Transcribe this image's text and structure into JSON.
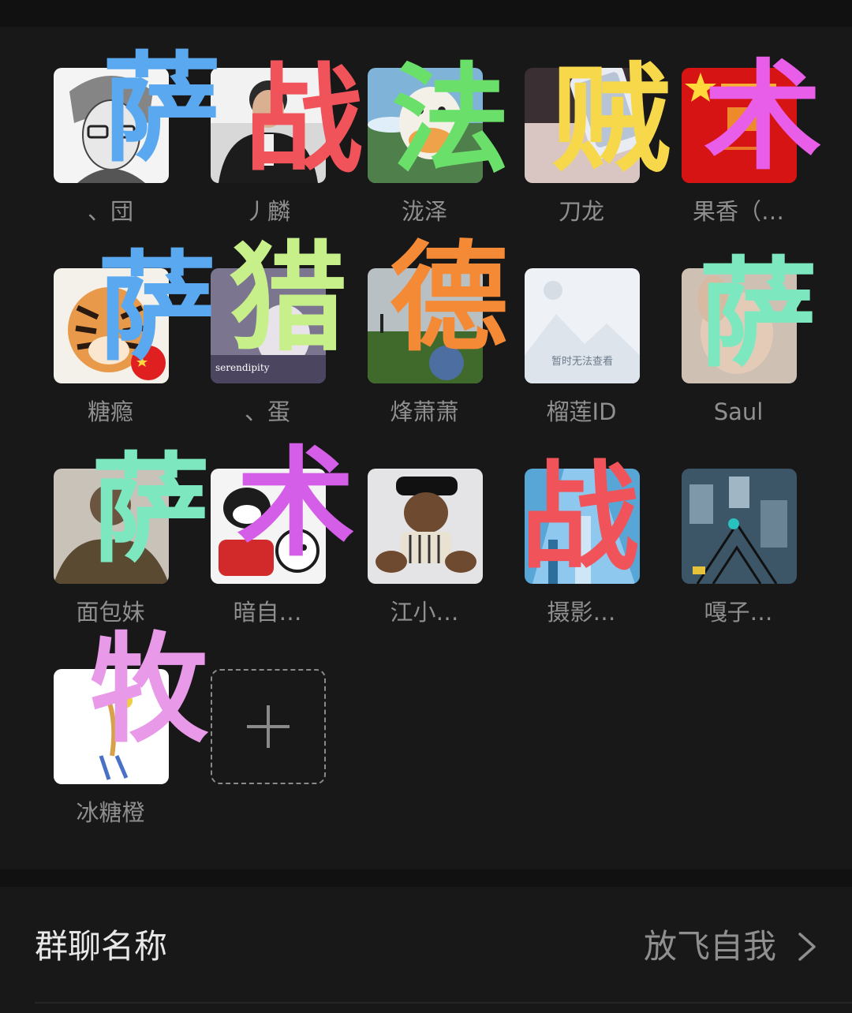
{
  "members": [
    {
      "name": "、団",
      "overlay_char": "萨",
      "overlay_color": "#5aa8f0",
      "avatar_icon": "anime-glasses-avatar"
    },
    {
      "name": "丿麟",
      "overlay_char": "战",
      "overlay_color": "#f0545a",
      "avatar_icon": "man-photo-avatar"
    },
    {
      "name": "泷泽",
      "overlay_char": "法",
      "overlay_color": "#6ae06a",
      "avatar_icon": "duck-photo-avatar"
    },
    {
      "name": "刀龙",
      "overlay_char": "贼",
      "overlay_color": "#f6d84a",
      "avatar_icon": "phone-photo-avatar"
    },
    {
      "name": "果香（…",
      "overlay_char": "术",
      "overlay_color": "#e85ee8",
      "avatar_icon": "red-flag-avatar"
    },
    {
      "name": "糖瘾",
      "overlay_char": "萨",
      "overlay_color": "#5aa8f0",
      "avatar_icon": "tiger-avatar"
    },
    {
      "name": "、蛋",
      "overlay_char": "猎",
      "overlay_color": "#c8f08a",
      "avatar_icon": "serendipity-avatar"
    },
    {
      "name": "烽萧萧",
      "overlay_char": "德",
      "overlay_color": "#f58a36",
      "avatar_icon": "field-photo-avatar"
    },
    {
      "name": "榴莲ID",
      "overlay_char": "",
      "overlay_color": "",
      "avatar_icon": "image-unavailable-avatar",
      "placeholder_text": "暂时无法查看"
    },
    {
      "name": "Saul",
      "overlay_char": "萨",
      "overlay_color": "#7de8c0",
      "avatar_icon": "hand-photo-avatar"
    },
    {
      "name": "面包妹",
      "overlay_char": "萨",
      "overlay_color": "#7de8c0",
      "avatar_icon": "person-photo-avatar"
    },
    {
      "name": "暗自…",
      "overlay_char": "术",
      "overlay_color": "#d55ee8",
      "avatar_icon": "cartoon-cat-avatar"
    },
    {
      "name": "江小…",
      "overlay_char": "",
      "overlay_color": "",
      "avatar_icon": "teddy-bear-avatar"
    },
    {
      "name": "摄影…",
      "overlay_char": "战",
      "overlay_color": "#f0545a",
      "avatar_icon": "building-photo-avatar"
    },
    {
      "name": "嘎子…",
      "overlay_char": "",
      "overlay_color": "",
      "avatar_icon": "city-aerial-avatar"
    },
    {
      "name": "冰糖橙",
      "overlay_char": "牧",
      "overlay_color": "#e89ae8",
      "avatar_icon": "drawing-avatar"
    }
  ],
  "add_member_icon": "plus-icon",
  "group_name_row": {
    "label": "群聊名称",
    "value": "放飞自我",
    "icon": "chevron-right-icon"
  },
  "colors": {
    "background": "#111111",
    "panel": "#181818",
    "name_text": "#8f8f8f",
    "label_text": "#e8e8e8"
  }
}
